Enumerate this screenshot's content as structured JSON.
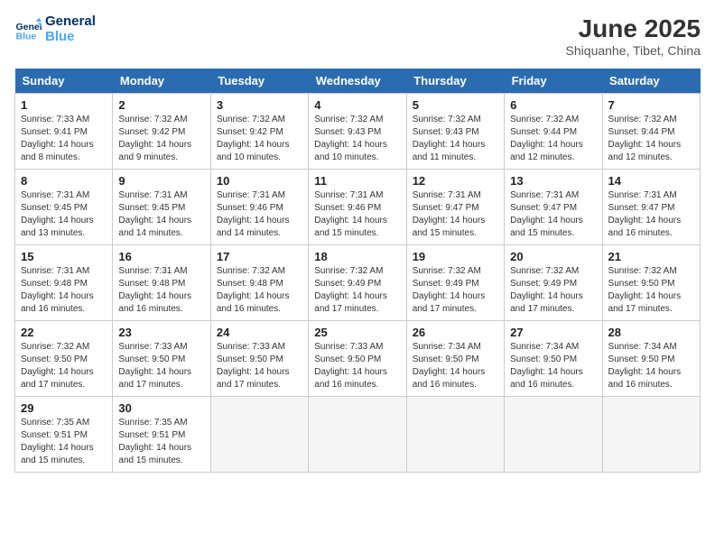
{
  "header": {
    "logo_line1": "General",
    "logo_line2": "Blue",
    "title": "June 2025",
    "subtitle": "Shiquanhe, Tibet, China"
  },
  "days_of_week": [
    "Sunday",
    "Monday",
    "Tuesday",
    "Wednesday",
    "Thursday",
    "Friday",
    "Saturday"
  ],
  "weeks": [
    [
      {
        "day": "1",
        "sunrise": "7:33 AM",
        "sunset": "9:41 PM",
        "daylight": "14 hours and 8 minutes."
      },
      {
        "day": "2",
        "sunrise": "7:32 AM",
        "sunset": "9:42 PM",
        "daylight": "14 hours and 9 minutes."
      },
      {
        "day": "3",
        "sunrise": "7:32 AM",
        "sunset": "9:42 PM",
        "daylight": "14 hours and 10 minutes."
      },
      {
        "day": "4",
        "sunrise": "7:32 AM",
        "sunset": "9:43 PM",
        "daylight": "14 hours and 10 minutes."
      },
      {
        "day": "5",
        "sunrise": "7:32 AM",
        "sunset": "9:43 PM",
        "daylight": "14 hours and 11 minutes."
      },
      {
        "day": "6",
        "sunrise": "7:32 AM",
        "sunset": "9:44 PM",
        "daylight": "14 hours and 12 minutes."
      },
      {
        "day": "7",
        "sunrise": "7:32 AM",
        "sunset": "9:44 PM",
        "daylight": "14 hours and 12 minutes."
      }
    ],
    [
      {
        "day": "8",
        "sunrise": "7:31 AM",
        "sunset": "9:45 PM",
        "daylight": "14 hours and 13 minutes."
      },
      {
        "day": "9",
        "sunrise": "7:31 AM",
        "sunset": "9:45 PM",
        "daylight": "14 hours and 14 minutes."
      },
      {
        "day": "10",
        "sunrise": "7:31 AM",
        "sunset": "9:46 PM",
        "daylight": "14 hours and 14 minutes."
      },
      {
        "day": "11",
        "sunrise": "7:31 AM",
        "sunset": "9:46 PM",
        "daylight": "14 hours and 15 minutes."
      },
      {
        "day": "12",
        "sunrise": "7:31 AM",
        "sunset": "9:47 PM",
        "daylight": "14 hours and 15 minutes."
      },
      {
        "day": "13",
        "sunrise": "7:31 AM",
        "sunset": "9:47 PM",
        "daylight": "14 hours and 15 minutes."
      },
      {
        "day": "14",
        "sunrise": "7:31 AM",
        "sunset": "9:47 PM",
        "daylight": "14 hours and 16 minutes."
      }
    ],
    [
      {
        "day": "15",
        "sunrise": "7:31 AM",
        "sunset": "9:48 PM",
        "daylight": "14 hours and 16 minutes."
      },
      {
        "day": "16",
        "sunrise": "7:31 AM",
        "sunset": "9:48 PM",
        "daylight": "14 hours and 16 minutes."
      },
      {
        "day": "17",
        "sunrise": "7:32 AM",
        "sunset": "9:48 PM",
        "daylight": "14 hours and 16 minutes."
      },
      {
        "day": "18",
        "sunrise": "7:32 AM",
        "sunset": "9:49 PM",
        "daylight": "14 hours and 17 minutes."
      },
      {
        "day": "19",
        "sunrise": "7:32 AM",
        "sunset": "9:49 PM",
        "daylight": "14 hours and 17 minutes."
      },
      {
        "day": "20",
        "sunrise": "7:32 AM",
        "sunset": "9:49 PM",
        "daylight": "14 hours and 17 minutes."
      },
      {
        "day": "21",
        "sunrise": "7:32 AM",
        "sunset": "9:50 PM",
        "daylight": "14 hours and 17 minutes."
      }
    ],
    [
      {
        "day": "22",
        "sunrise": "7:32 AM",
        "sunset": "9:50 PM",
        "daylight": "14 hours and 17 minutes."
      },
      {
        "day": "23",
        "sunrise": "7:33 AM",
        "sunset": "9:50 PM",
        "daylight": "14 hours and 17 minutes."
      },
      {
        "day": "24",
        "sunrise": "7:33 AM",
        "sunset": "9:50 PM",
        "daylight": "14 hours and 17 minutes."
      },
      {
        "day": "25",
        "sunrise": "7:33 AM",
        "sunset": "9:50 PM",
        "daylight": "14 hours and 16 minutes."
      },
      {
        "day": "26",
        "sunrise": "7:34 AM",
        "sunset": "9:50 PM",
        "daylight": "14 hours and 16 minutes."
      },
      {
        "day": "27",
        "sunrise": "7:34 AM",
        "sunset": "9:50 PM",
        "daylight": "14 hours and 16 minutes."
      },
      {
        "day": "28",
        "sunrise": "7:34 AM",
        "sunset": "9:50 PM",
        "daylight": "14 hours and 16 minutes."
      }
    ],
    [
      {
        "day": "29",
        "sunrise": "7:35 AM",
        "sunset": "9:51 PM",
        "daylight": "14 hours and 15 minutes."
      },
      {
        "day": "30",
        "sunrise": "7:35 AM",
        "sunset": "9:51 PM",
        "daylight": "14 hours and 15 minutes."
      },
      null,
      null,
      null,
      null,
      null
    ]
  ]
}
